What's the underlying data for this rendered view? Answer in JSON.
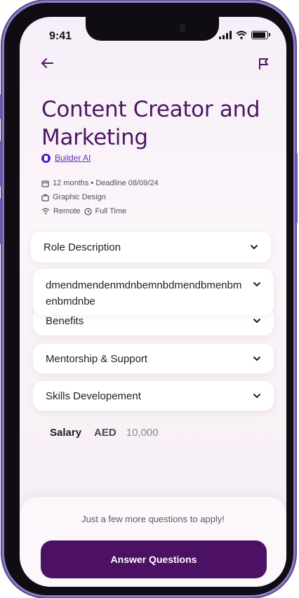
{
  "status": {
    "time": "9:41"
  },
  "job": {
    "title": "Content Creator and Marketing",
    "company": "Builder AI",
    "duration_deadline": "12 months • Deadline 08/09/24",
    "category": "Graphic Design",
    "location": "Remote",
    "type": "Full Time"
  },
  "sections": {
    "role": "Role Description",
    "expanded_text": "dmendmendenmdnbemnbdmendbmenbmenbmdnbe",
    "benefits": "Benefits",
    "mentorship": "Mentorship & Support",
    "skills": "Skills Developement"
  },
  "salary": {
    "label": "Salary",
    "currency": "AED",
    "amount": "10,000"
  },
  "footer": {
    "hint": "Just a few more questions to apply!",
    "button": "Answer Questions"
  },
  "colors": {
    "brand": "#4c1163",
    "accent": "#6b2fb8"
  }
}
